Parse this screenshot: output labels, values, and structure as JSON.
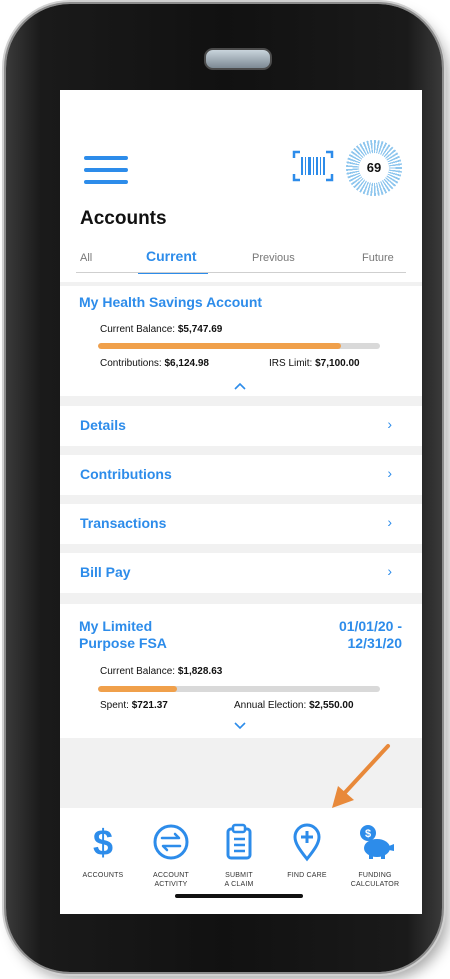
{
  "header": {
    "title": "Accounts",
    "score": "69"
  },
  "tabs": [
    {
      "label": "All"
    },
    {
      "label": "Current"
    },
    {
      "label": "Previous"
    },
    {
      "label": "Future"
    }
  ],
  "hsa": {
    "name": "My Health Savings Account",
    "balance_label": "Current Balance:",
    "balance_value": "$5,747.69",
    "contrib_label": "Contributions:",
    "contrib_value": "$6,124.98",
    "limit_label": "IRS Limit:",
    "limit_value": "$7,100.00",
    "progress_fraction": 0.86
  },
  "menu_rows": [
    {
      "label": "Details",
      "arrow": "›"
    },
    {
      "label": "Contributions",
      "arrow": "›"
    },
    {
      "label": "Transactions",
      "arrow": "›"
    },
    {
      "label": "Bill Pay",
      "arrow": "›"
    }
  ],
  "fsa": {
    "name_line1": "My Limited",
    "name_line2": "Purpose FSA",
    "date_line1": "01/01/20 -",
    "date_line2": "12/31/20",
    "balance_label": "Current Balance:",
    "balance_value": "$1,828.63",
    "spent_label": "Spent:",
    "spent_value": "$721.37",
    "election_label": "Annual Election:",
    "election_value": "$2,550.00",
    "progress_fraction": 0.28
  },
  "bottom_nav": [
    {
      "line1": "ACCOUNTS",
      "line2": "",
      "icon": "dollar-icon"
    },
    {
      "line1": "ACCOUNT",
      "line2": "ACTIVITY",
      "icon": "transfer-icon"
    },
    {
      "line1": "SUBMIT",
      "line2": "A CLAIM",
      "icon": "clipboard-icon"
    },
    {
      "line1": "FIND CARE",
      "line2": "",
      "icon": "map-pin-plus-icon"
    },
    {
      "line1": "FUNDING",
      "line2": "CALCULATOR",
      "icon": "piggy-bank-icon"
    }
  ],
  "colors": {
    "accent": "#2d8cea",
    "progress": "#f0a04b",
    "annotation_arrow": "#e8893a"
  }
}
